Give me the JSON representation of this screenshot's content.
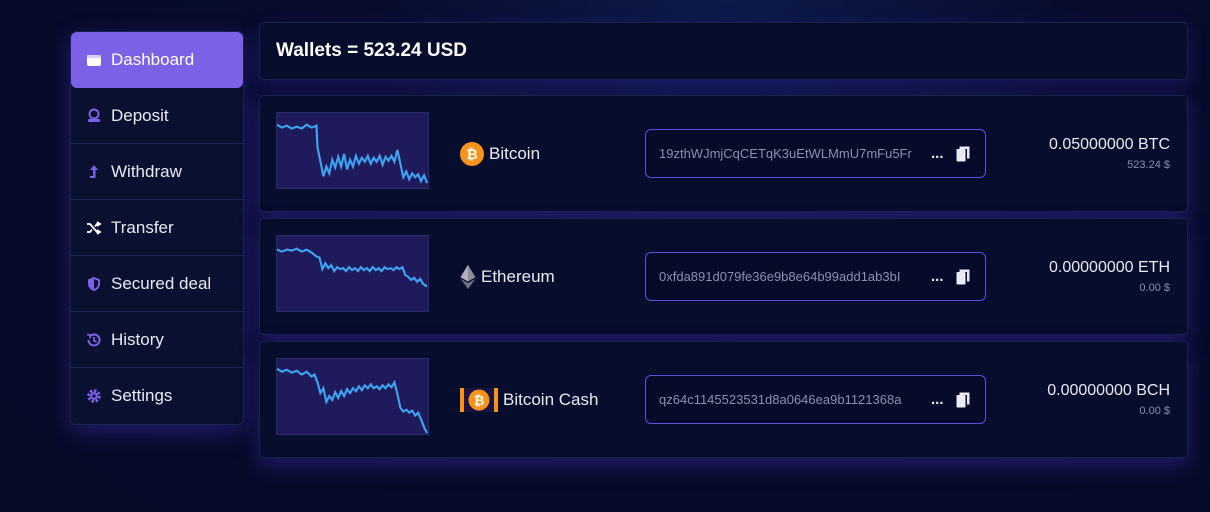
{
  "sidebar": {
    "items": [
      {
        "label": "Dashboard",
        "icon": "wallet-icon",
        "active": true
      },
      {
        "label": "Deposit",
        "icon": "deposit-icon"
      },
      {
        "label": "Withdraw",
        "icon": "withdraw-icon"
      },
      {
        "label": "Transfer",
        "icon": "transfer-icon"
      },
      {
        "label": "Secured deal",
        "icon": "shield-icon"
      },
      {
        "label": "History",
        "icon": "history-icon"
      },
      {
        "label": "Settings",
        "icon": "gear-icon"
      }
    ]
  },
  "header": {
    "title": "Wallets = 523.24 USD"
  },
  "colors": {
    "accent": "#7b61e6",
    "chart_line": "#3fa2f0",
    "chart_bg": "#1e1a5c",
    "btc": "#f7931a",
    "eth": "#8c8c9c"
  },
  "wallets": [
    {
      "name": "Bitcoin",
      "icon": "bitcoin-icon",
      "address": "19zthWJmjCqCETqK3uEtWLMmU7mFu5Fr",
      "dots": "...",
      "balance": "0.05000000 BTC",
      "usd": "523.24 $"
    },
    {
      "name": "Ethereum",
      "icon": "ethereum-icon",
      "address": "0xfda891d079fe36e9b8e64b99add1ab3bI",
      "dots": "...",
      "balance": "0.00000000 ETH",
      "usd": "0.00 $"
    },
    {
      "name": "Bitcoin Cash",
      "icon": "bitcoin-cash-icon",
      "address": "qz64c1145523531d8a0646ea9b1121368a",
      "dots": "...",
      "balance": "0.00000000 BCH",
      "usd": "0.00 $"
    }
  ]
}
